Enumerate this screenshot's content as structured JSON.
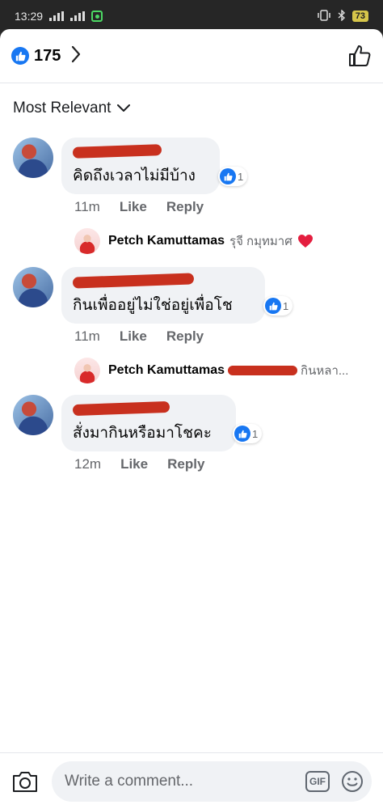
{
  "status_bar": {
    "time": "13:29",
    "battery": "73"
  },
  "reactions": {
    "icon": "like-icon",
    "count": "175"
  },
  "sort": {
    "label": "Most Relevant"
  },
  "comments": [
    {
      "text": "คิดถึงเวลาไม่มีบ้าง",
      "reaction_count": "1",
      "time": "11m",
      "like_label": "Like",
      "reply_label": "Reply",
      "reply_preview": {
        "name": "Petch Kamuttamas",
        "snippet": "รุจี กมุทมาศ"
      }
    },
    {
      "text": "กินเพื่ออยู่ไม่ใช่อยู่เพื่อโช",
      "reaction_count": "1",
      "time": "11m",
      "like_label": "Like",
      "reply_label": "Reply",
      "reply_preview": {
        "name": "Petch Kamuttamas",
        "snippet": "กินหลา..."
      }
    },
    {
      "text": "สั่งมากินหรือมาโชคะ",
      "reaction_count": "1",
      "time": "12m",
      "like_label": "Like",
      "reply_label": "Reply"
    }
  ],
  "composer": {
    "placeholder": "Write a comment...",
    "gif_label": "GIF"
  },
  "colors": {
    "accent": "#1877f2",
    "redaction": "#c8301e",
    "heart": "#e41e3f"
  }
}
